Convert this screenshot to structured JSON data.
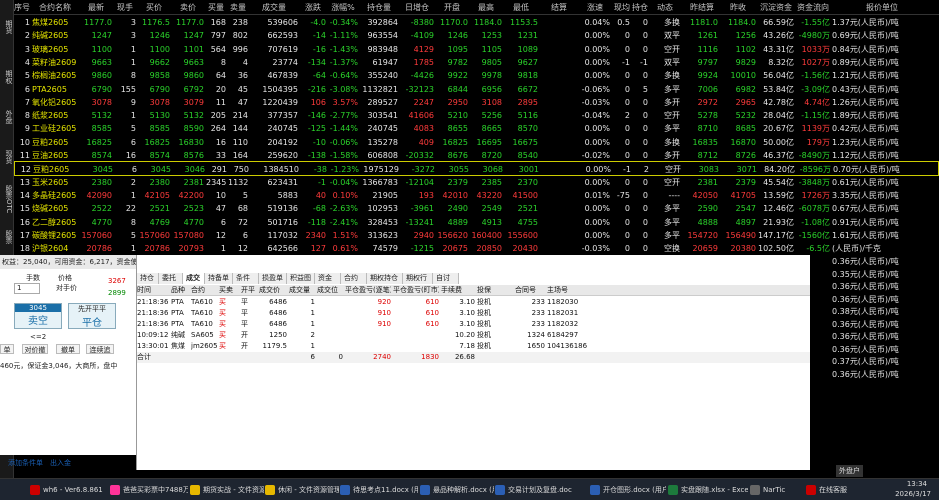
{
  "sidebar": {
    "tabs": [
      "期货",
      "期权",
      "外盘",
      "现货",
      "股票OTC",
      "股票"
    ]
  },
  "quote": {
    "headers": [
      "序号",
      "合约名称",
      "最新",
      "现手",
      "买价",
      "卖价",
      "买量",
      "卖量",
      "成交量",
      "涨跌",
      "涨幅%",
      "持仓量",
      "日增仓",
      "开盘",
      "最高",
      "最低",
      "结算",
      "涨速",
      "现均差",
      "持仓比",
      "动态",
      "昨结算",
      "昨收",
      "沉淀资金",
      "资金流向",
      "报价单位"
    ],
    "rows": [
      [
        "1",
        "焦煤2605",
        "1177.0",
        "3",
        "1176.5",
        "1177.0",
        "168",
        "238",
        "539606",
        "-4.0",
        "-0.34%",
        "392864",
        "-8380",
        "1170.0",
        "1184.0",
        "1153.5",
        "",
        "0.04%",
        "0.5",
        "0",
        "多换",
        "1181.0",
        "1184.0",
        "66.59亿",
        "-1.55亿",
        "1.37元(人民币)/吨"
      ],
      [
        "2",
        "纯碱2605",
        "1247",
        "3",
        "1246",
        "1247",
        "797",
        "802",
        "662593",
        "-14",
        "-1.11%",
        "963554",
        "-4109",
        "1246",
        "1253",
        "1231",
        "",
        "0.00%",
        "0",
        "0",
        "双平",
        "1261",
        "1256",
        "43.26亿",
        "-4980万",
        "0.69元(人民币)/吨"
      ],
      [
        "3",
        "玻璃2605",
        "1100",
        "1",
        "1100",
        "1101",
        "564",
        "996",
        "707619",
        "-16",
        "-1.43%",
        "983948",
        "4129",
        "1095",
        "1105",
        "1089",
        "",
        "0.00%",
        "0",
        "0",
        "空开",
        "1116",
        "1102",
        "43.31亿",
        "1033万",
        "0.84元(人民币)/吨"
      ],
      [
        "4",
        "菜籽油2609",
        "9663",
        "1",
        "9662",
        "9663",
        "8",
        "4",
        "23774",
        "-134",
        "-1.37%",
        "61947",
        "1785",
        "9782",
        "9805",
        "9627",
        "",
        "0.00%",
        "-1",
        "-1",
        "双平",
        "9797",
        "9829",
        "8.32亿",
        "1027万",
        "0.89元(人民币)/吨"
      ],
      [
        "5",
        "棕榈油2605",
        "9860",
        "8",
        "9858",
        "9860",
        "64",
        "36",
        "467839",
        "-64",
        "-0.64%",
        "355240",
        "-4426",
        "9922",
        "9978",
        "9818",
        "",
        "0.00%",
        "0",
        "0",
        "多换",
        "9924",
        "10010",
        "56.04亿",
        "-1.56亿",
        "1.21元(人民币)/吨"
      ],
      [
        "6",
        "PTA2605",
        "6790",
        "155",
        "6790",
        "6792",
        "20",
        "45",
        "1504395",
        "-216",
        "-3.08%",
        "1132821",
        "-32123",
        "6844",
        "6956",
        "6672",
        "",
        "-0.06%",
        "0",
        "5",
        "多平",
        "7006",
        "6982",
        "53.84亿",
        "-3.09亿",
        "0.43元(人民币)/吨"
      ],
      [
        "7",
        "氧化铝2605",
        "3078",
        "9",
        "3078",
        "3079",
        "11",
        "47",
        "1220439",
        "106",
        "3.57%",
        "289527",
        "2247",
        "2950",
        "3108",
        "2895",
        "",
        "-0.03%",
        "0",
        "0",
        "多开",
        "2972",
        "2965",
        "42.78亿",
        "4.74亿",
        "1.26元(人民币)/吨"
      ],
      [
        "8",
        "纸浆2605",
        "5132",
        "1",
        "5130",
        "5132",
        "205",
        "214",
        "377357",
        "-146",
        "-2.77%",
        "303541",
        "41606",
        "5210",
        "5256",
        "5116",
        "",
        "-0.04%",
        "2",
        "0",
        "空开",
        "5278",
        "5232",
        "28.04亿",
        "-1.15亿",
        "1.89元(人民币)/吨"
      ],
      [
        "9",
        "工业硅2605",
        "8585",
        "5",
        "8585",
        "8590",
        "264",
        "144",
        "240745",
        "-125",
        "-1.44%",
        "240745",
        "4083",
        "8655",
        "8665",
        "8570",
        "",
        "0.00%",
        "0",
        "0",
        "多平",
        "8710",
        "8685",
        "20.67亿",
        "1139万",
        "0.42元(人民币)/吨"
      ],
      [
        "10",
        "豆粕2605",
        "16825",
        "6",
        "16825",
        "16830",
        "16",
        "110",
        "204192",
        "-10",
        "-0.06%",
        "135278",
        "409",
        "16825",
        "16695",
        "16675",
        "",
        "0.00%",
        "0",
        "0",
        "多换",
        "16835",
        "16870",
        "50.00亿",
        "179万",
        "1.23元(人民币)/吨"
      ],
      [
        "11",
        "豆油2605",
        "8574",
        "16",
        "8574",
        "8576",
        "33",
        "164",
        "259620",
        "-138",
        "-1.58%",
        "606808",
        "-20332",
        "8676",
        "8720",
        "8540",
        "",
        "-0.02%",
        "0",
        "0",
        "多开",
        "8712",
        "8726",
        "46.37亿",
        "-8490万",
        "1.12元(人民币)/吨"
      ],
      [
        "12",
        "豆粕2605",
        "3045",
        "6",
        "3045",
        "3046",
        "291",
        "750",
        "1384510",
        "-38",
        "-1.23%",
        "1975129",
        "-3272",
        "3055",
        "3068",
        "3001",
        "",
        "0.00%",
        "-1",
        "2",
        "空开",
        "3083",
        "3071",
        "84.20亿",
        "-8596万",
        "0.70元(人民币)/吨"
      ],
      [
        "13",
        "玉米2605",
        "2380",
        "2",
        "2380",
        "2381",
        "2345",
        "1132",
        "623431",
        "-1",
        "-0.04%",
        "1366783",
        "-12104",
        "2379",
        "2385",
        "2370",
        "",
        "0.00%",
        "0",
        "0",
        "空开",
        "2381",
        "2379",
        "45.54亿",
        "-3848万",
        "0.61元(人民币)/吨"
      ],
      [
        "14",
        "多晶硅2605",
        "42090",
        "1",
        "42105",
        "42200",
        "10",
        "5",
        "5883",
        "40",
        "0.10%",
        "21905",
        "193",
        "42010",
        "43220",
        "41500",
        "",
        "0.01%",
        "-75",
        "0",
        "----",
        "42050",
        "41705",
        "13.59亿",
        "1726万",
        "3.35元(人民币)/吨"
      ],
      [
        "15",
        "烧碱2605",
        "2522",
        "22",
        "2521",
        "2523",
        "47",
        "68",
        "519136",
        "-68",
        "-2.63%",
        "102953",
        "-3961",
        "2490",
        "2549",
        "2521",
        "",
        "0.00%",
        "0",
        "0",
        "多平",
        "2590",
        "2547",
        "12.46亿",
        "-6078万",
        "0.67元(人民币)/吨"
      ],
      [
        "16",
        "乙二醇2605",
        "4770",
        "8",
        "4769",
        "4770",
        "6",
        "72",
        "501716",
        "-118",
        "-2.41%",
        "328453",
        "-13241",
        "4889",
        "4913",
        "4755",
        "",
        "0.00%",
        "0",
        "0",
        "多平",
        "4888",
        "4897",
        "21.93亿",
        "-1.08亿",
        "0.91元(人民币)/吨"
      ],
      [
        "17",
        "碳酸锂2605",
        "157060",
        "5",
        "157060",
        "157080",
        "12",
        "6",
        "117032",
        "2340",
        "1.51%",
        "313623",
        "2940",
        "156620",
        "160400",
        "155600",
        "",
        "0.00%",
        "0",
        "0",
        "多平",
        "154720",
        "156490",
        "147.17亿",
        "-1560亿",
        "1.61元(人民币)/吨"
      ],
      [
        "18",
        "沪银2604",
        "20786",
        "1",
        "20786",
        "20793",
        "1",
        "12",
        "642566",
        "127",
        "0.61%",
        "74579",
        "-1215",
        "20675",
        "20850",
        "20430",
        "",
        "-0.03%",
        "0",
        "0",
        "空换",
        "20659",
        "20380",
        "102.50亿",
        "-6.5亿",
        "(人民币)/千克"
      ]
    ],
    "extra_right": [
      "0.36元(人民币)/吨",
      "0.35元(人民币)/吨",
      "0.36元(人民币)/吨",
      "0.36元(人民币)/吨",
      "0.38元(人民币)/吨",
      "0.36元(人民币)/吨",
      "0.36元(人民币)/吨",
      "0.36元(人民币)/吨",
      "0.37元(人民币)/吨",
      "0.36元(人民币)/吨"
    ]
  },
  "account_bar": "权益：25,040，可用资金：6,217，资金使用率：75.17%",
  "ticket": {
    "qty_label": "手数",
    "price_label": "价格",
    "price_mode": "对手价",
    "qty_value": "1",
    "bid_px": "3267",
    "ask_px": "2899",
    "buy_price": "3045",
    "sell_open_label": "卖空",
    "close_first_label": "先开平平",
    "close_label": "平仓",
    "ratio": "<=2",
    "btn_orders": "单",
    "btn_cancel": "对价撤",
    "btn_cancel_all": "撤单",
    "btn_chain": "连续追",
    "fee_line": "460元，保证金3,046，大商所，盘中",
    "add_cond_label": "添加条件单",
    "market_label": "出入金"
  },
  "orders": {
    "tabs": [
      "持仓",
      "委托",
      "成交",
      "持备单",
      "条件单",
      "损盈单",
      "积益图",
      "资金表",
      "合约表",
      "期权持仓表",
      "期权行权",
      "自讨单"
    ],
    "headers": [
      "时间",
      "品种",
      "合约",
      "买卖",
      "开平",
      "成交价",
      "成交量",
      "成交位",
      "平仓盈亏(逐笔)",
      "平仓盈亏(盯市)",
      "手续费",
      "投保",
      "合同号",
      "主场号"
    ],
    "rows": [
      [
        "21:18:36",
        "PTA",
        "TA610",
        "买",
        "平",
        "6486",
        "1",
        "",
        "920",
        "610",
        "3.10",
        "投机",
        "233",
        "1182030"
      ],
      [
        "21:18:36",
        "PTA",
        "TA610",
        "买",
        "平",
        "6486",
        "1",
        "",
        "910",
        "610",
        "3.10",
        "投机",
        "233",
        "1182031"
      ],
      [
        "21:18:36",
        "PTA",
        "TA610",
        "买",
        "平",
        "6486",
        "1",
        "",
        "910",
        "610",
        "3.10",
        "投机",
        "233",
        "1182032"
      ],
      [
        "10:09:12",
        "纯碱",
        "SA605",
        "买",
        "开",
        "1250",
        "2",
        "",
        "",
        "",
        "10.20",
        "投机",
        "1324",
        "6184297"
      ],
      [
        "13:30:01",
        "焦煤",
        "jm2605",
        "买",
        "开",
        "1179.5",
        "1",
        "",
        "",
        "",
        "7.18",
        "投机",
        "1650",
        "104136186"
      ],
      [
        "合计",
        "",
        "",
        "",
        "",
        "",
        "6",
        "0",
        "2740",
        "1830",
        "26.68",
        "",
        "",
        ""
      ]
    ]
  },
  "taskbar": {
    "items": [
      "wh6 - Ver6.8.861",
      "爸爸买彩票中7488万才",
      "期货实战 - 文件资源管",
      "休闲 - 文件资源管理",
      "待思考点11.docx (用户",
      "悬品种解析.docx (用户",
      "交易计划及复盘.doc",
      "开仓图形.docx (用户",
      "实盘跟随.xlsx - Excel",
      "NarTic",
      "在线客服"
    ],
    "time": "13:34",
    "date": "2026/3/17",
    "sidebar_label": "外盘户"
  },
  "colors": {
    "bg": "#000000",
    "up": "#ff3b3b",
    "down": "#2bd42b",
    "selected_border": "#cccc00"
  }
}
